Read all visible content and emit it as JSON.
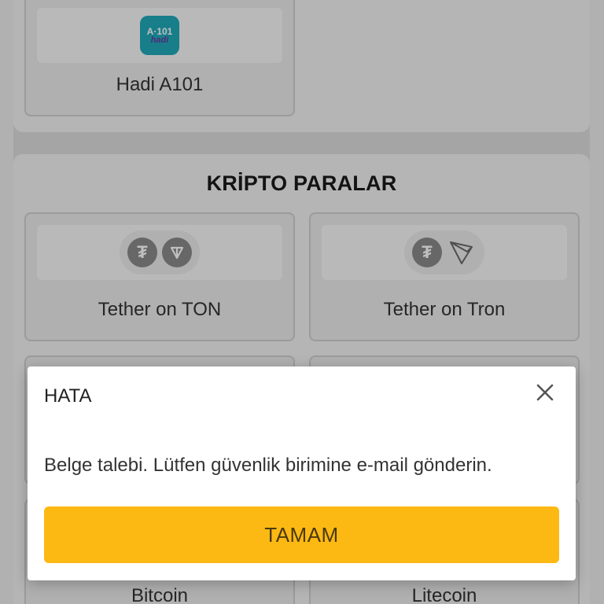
{
  "payment_methods": {
    "top_card": {
      "label": "Hadi A101",
      "logo_line1": "A·101",
      "logo_line2": "hadi"
    },
    "crypto_section": {
      "title": "KRİPTO PARALAR",
      "cards": [
        {
          "label": "Tether on TON",
          "icons": [
            "tether-icon",
            "ton-icon"
          ]
        },
        {
          "label": "Tether on Tron",
          "icons": [
            "tether-icon",
            "tron-icon"
          ]
        },
        {
          "label": "Bitcoin"
        },
        {
          "label": "Litecoin"
        }
      ]
    }
  },
  "dialog": {
    "title": "HATA",
    "message": "Belge talebi. Lütfen güvenlik birimine e-mail gönderin.",
    "confirm_label": "TAMAM",
    "button_color": "#fdb913"
  }
}
